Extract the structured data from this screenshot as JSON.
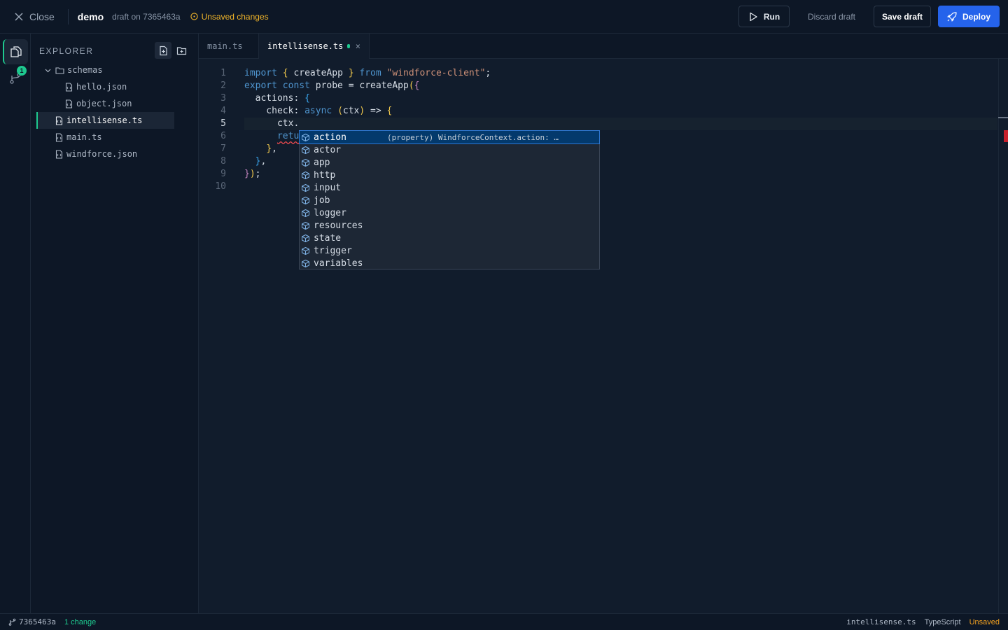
{
  "topbar": {
    "close_label": "Close",
    "project_name": "demo",
    "draft_info": "draft on 7365463a",
    "unsaved_label": "Unsaved changes",
    "run_label": "Run",
    "discard_label": "Discard draft",
    "save_label": "Save draft",
    "deploy_label": "Deploy"
  },
  "activity": {
    "git_badge": "1"
  },
  "explorer": {
    "title": "EXPLORER",
    "items": [
      {
        "label": "schemas",
        "type": "folder"
      },
      {
        "label": "hello.json",
        "type": "file"
      },
      {
        "label": "object.json",
        "type": "file"
      },
      {
        "label": "intellisense.ts",
        "type": "file",
        "selected": true
      },
      {
        "label": "main.ts",
        "type": "file"
      },
      {
        "label": "windforce.json",
        "type": "file"
      }
    ]
  },
  "tabs": [
    {
      "label": "main.ts"
    },
    {
      "label": "intellisense.ts",
      "active": true,
      "modified": true,
      "close": "×"
    }
  ],
  "editor": {
    "current_line": 5,
    "lines": [
      {
        "n": "1",
        "parts": [
          [
            "kw",
            "import "
          ],
          [
            "b1",
            "{"
          ],
          [
            "",
            " createApp "
          ],
          [
            "b1",
            "}"
          ],
          [
            "kw",
            " from "
          ],
          [
            "str",
            "\"windforce-client\""
          ],
          [
            "",
            ";"
          ]
        ]
      },
      {
        "n": "2",
        "parts": [
          [
            "kw",
            "export const "
          ],
          [
            "",
            "probe = createApp"
          ],
          [
            "b1",
            "("
          ],
          [
            "b2",
            "{"
          ]
        ]
      },
      {
        "n": "3",
        "parts": [
          [
            "",
            "  actions: "
          ],
          [
            "b3",
            "{"
          ]
        ]
      },
      {
        "n": "4",
        "parts": [
          [
            "",
            "    check: "
          ],
          [
            "kw",
            "async "
          ],
          [
            "b1",
            "("
          ],
          [
            "",
            "ctx"
          ],
          [
            "b1",
            ")"
          ],
          [
            "",
            " => "
          ],
          [
            "b1",
            "{"
          ]
        ]
      },
      {
        "n": "5",
        "parts": [
          [
            "",
            "      ctx."
          ]
        ]
      },
      {
        "n": "6",
        "parts": [
          [
            "",
            "      "
          ],
          [
            "kw squig",
            "retu"
          ]
        ]
      },
      {
        "n": "7",
        "parts": [
          [
            "",
            "    "
          ],
          [
            "b1",
            "}"
          ],
          [
            "",
            ","
          ]
        ]
      },
      {
        "n": "8",
        "parts": [
          [
            "",
            "  "
          ],
          [
            "b3",
            "}"
          ],
          [
            "",
            ","
          ]
        ]
      },
      {
        "n": "9",
        "parts": [
          [
            "b2",
            "}"
          ],
          [
            "b1",
            ")"
          ],
          [
            "",
            ";"
          ]
        ]
      },
      {
        "n": "10",
        "parts": []
      }
    ]
  },
  "suggestions": {
    "items": [
      "action",
      "actor",
      "app",
      "http",
      "input",
      "job",
      "logger",
      "resources",
      "state",
      "trigger",
      "variables"
    ],
    "active_index": 0,
    "active_detail": "(property) WindforceContext.action: …",
    "icon": "cube-icon"
  },
  "statusbar": {
    "branch": "7365463a",
    "changes": "1 change",
    "file": "intellisense.ts",
    "language": "TypeScript",
    "state": "Unsaved"
  },
  "colors": {
    "accent": "#1ec98f",
    "primary": "#2563eb",
    "warning": "#f0b429",
    "error": "#e5484d"
  }
}
